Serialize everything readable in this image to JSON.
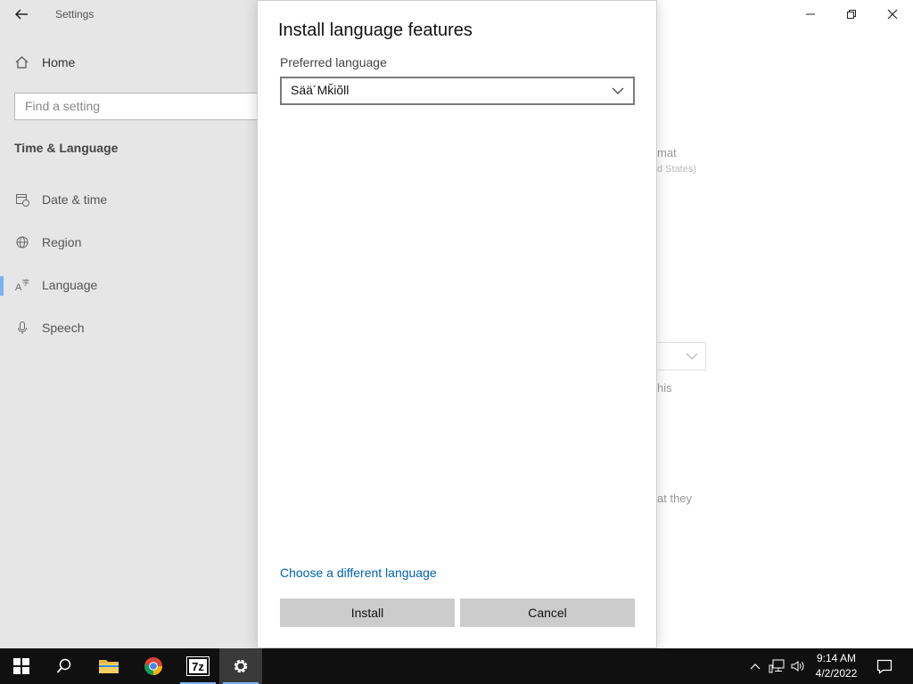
{
  "app": {
    "title": "Settings"
  },
  "sidebar": {
    "home_label": "Home",
    "search_placeholder": "Find a setting",
    "section_title": "Time & Language",
    "items": [
      {
        "label": "Date & time",
        "icon": "calendar-clock-icon"
      },
      {
        "label": "Region",
        "icon": "globe-icon"
      },
      {
        "label": "Language",
        "icon": "language-icon",
        "selected": true
      },
      {
        "label": "Speech",
        "icon": "microphone-icon"
      }
    ]
  },
  "background_content": {
    "frag1": "mat",
    "frag2": "d States)",
    "frag3": "his",
    "frag4": "at they"
  },
  "dialog": {
    "title": "Install language features",
    "preferred_label": "Preferred language",
    "selected_language": "Sää´Mǩiõll",
    "choose_link": "Choose a different language",
    "install_label": "Install",
    "cancel_label": "Cancel"
  },
  "taskbar": {
    "apps": [
      "start-icon",
      "search-icon",
      "file-explorer-icon",
      "chrome-icon",
      "7zip-icon",
      "settings-icon"
    ],
    "zip_label": "7z",
    "time": "9:14 AM",
    "date": "4/2/2022"
  },
  "colors": {
    "accent": "#0063b1",
    "taskbar": "#101010",
    "indicator": "#7ab4f0"
  }
}
